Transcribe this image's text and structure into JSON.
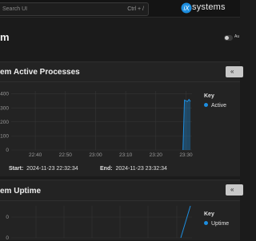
{
  "header": {
    "search_placeholder": "Search UI",
    "shortcut": "Ctrl + /",
    "logo_text": "systems"
  },
  "page": {
    "title": "m",
    "auto_refresh_label": "Au"
  },
  "cards": [
    {
      "title": "em Active Processes",
      "key_title": "Key",
      "series_name": "Active",
      "start_label": "Start:",
      "start_value": "2024-11-23 22:32:34",
      "end_label": "End:",
      "end_value": "2024-11-23 23:32:34"
    },
    {
      "title": "em Uptime",
      "key_title": "Key",
      "series_name": "Uptime"
    }
  ],
  "colors": {
    "accent": "#1d8ee0",
    "background": "#1b1b1b",
    "card": "#232323"
  },
  "icons": [
    "chevron-left-double-icon",
    "ix-logo-icon"
  ],
  "chart_data": [
    {
      "type": "area",
      "title": "em Active Processes",
      "xlabel": "",
      "ylabel": "",
      "x_ticks": [
        "22:40",
        "22:50",
        "23:00",
        "23:10",
        "23:20",
        "23:30"
      ],
      "y_ticks": [
        0,
        100,
        200,
        300,
        400
      ],
      "ylim": [
        0,
        420
      ],
      "xlim": [
        "22:32",
        "23:32"
      ],
      "series": [
        {
          "name": "Active",
          "color": "#1d8ee0",
          "x": [
            "23:29",
            "23:29.5",
            "23:30",
            "23:30.5",
            "23:31",
            "23:31.5"
          ],
          "y": [
            0,
            355,
            350,
            345,
            360,
            345
          ]
        }
      ],
      "grid": true,
      "legend": "right"
    },
    {
      "type": "line",
      "title": "em Uptime",
      "xlabel": "",
      "ylabel": "",
      "y_ticks": [
        0,
        0
      ],
      "series": [
        {
          "name": "Uptime",
          "color": "#1d8ee0",
          "x": [
            "23:29",
            "23:32"
          ],
          "y": [
            0,
            1
          ]
        }
      ],
      "grid": true,
      "legend": "right"
    }
  ]
}
